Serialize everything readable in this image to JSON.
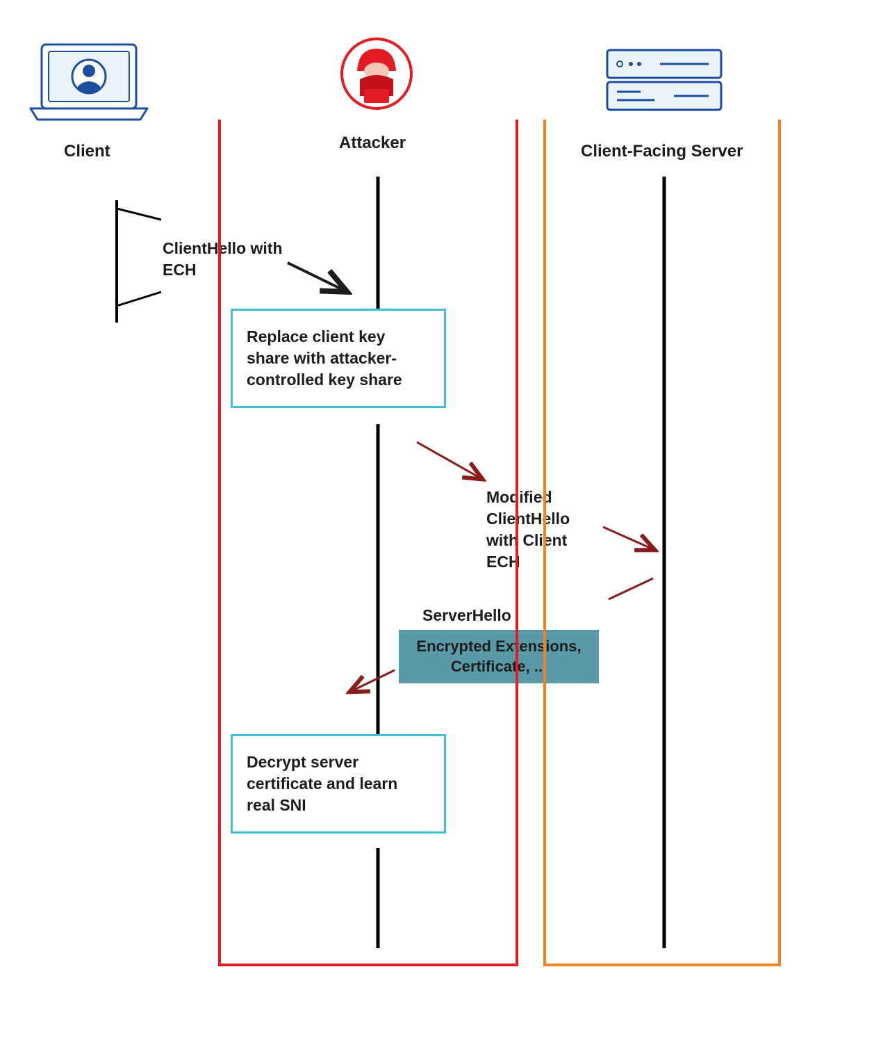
{
  "actors": {
    "client": "Client",
    "attacker": "Attacker",
    "server": "Client-Facing Server"
  },
  "messages": {
    "client_hello": "ClientHello with ECH",
    "replace_box": "Replace client key share with attacker-controlled key share",
    "modified_hello": "Modified ClientHello with Client ECH",
    "server_hello": "ServerHello",
    "encrypted": "Encrypted Extensions, Certificate, ...",
    "decrypt_box": "Decrypt server certificate and learn real SNI"
  },
  "colors": {
    "attacker_red": "#e31b23",
    "server_orange": "#f58220",
    "box_cyan": "#46bdd8",
    "enc_teal": "#5a9aa8",
    "client_blue": "#1b4ea0",
    "arrow_dark_red": "#8b1a1a"
  }
}
